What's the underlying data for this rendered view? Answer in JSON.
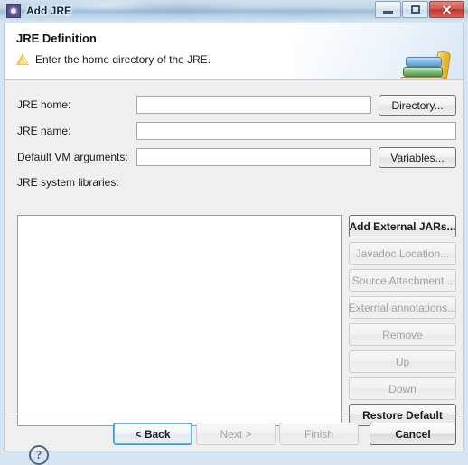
{
  "window": {
    "title": "Add JRE",
    "icon": "jre-gear-icon",
    "controls": {
      "minimize": "minimize-icon",
      "maximize": "maximize-icon",
      "close": "✕"
    }
  },
  "header": {
    "title": "JRE Definition",
    "status_icon": "warning-triangle-icon",
    "message": "Enter the home directory of the JRE.",
    "banner_icon": "books-stack-icon"
  },
  "form": {
    "fields": [
      {
        "label": "JRE home:",
        "value": "",
        "placeholder": ""
      },
      {
        "label": "JRE name:",
        "value": "",
        "placeholder": ""
      },
      {
        "label": "Default VM arguments:",
        "value": "",
        "placeholder": ""
      }
    ],
    "directory_button": "Directory...",
    "variables_button": "Variables...",
    "libraries_label": "JRE system libraries:",
    "libraries_items": []
  },
  "side_buttons": [
    {
      "label": "Add External JARs...",
      "enabled": true
    },
    {
      "label": "Javadoc Location...",
      "enabled": false
    },
    {
      "label": "Source Attachment...",
      "enabled": false
    },
    {
      "label": "External annotations...",
      "enabled": false
    },
    {
      "label": "Remove",
      "enabled": false
    },
    {
      "label": "Up",
      "enabled": false
    },
    {
      "label": "Down",
      "enabled": false
    },
    {
      "label": "Restore Default",
      "enabled": true
    }
  ],
  "footer": {
    "help_icon": "?",
    "buttons": [
      {
        "label": "< Back",
        "enabled": true,
        "focused": true
      },
      {
        "label": "Next >",
        "enabled": false,
        "focused": false
      },
      {
        "label": "Finish",
        "enabled": false,
        "focused": false
      },
      {
        "label": "Cancel",
        "enabled": true,
        "focused": false
      }
    ]
  },
  "colors": {
    "dialog_bg": "#efefef",
    "header_bg": "#ffffff",
    "titlebar_accent": "#9fbdd8",
    "close_button": "#b93a33",
    "focus_ring": "#3c9cd8",
    "warning": "#f0c14b"
  }
}
